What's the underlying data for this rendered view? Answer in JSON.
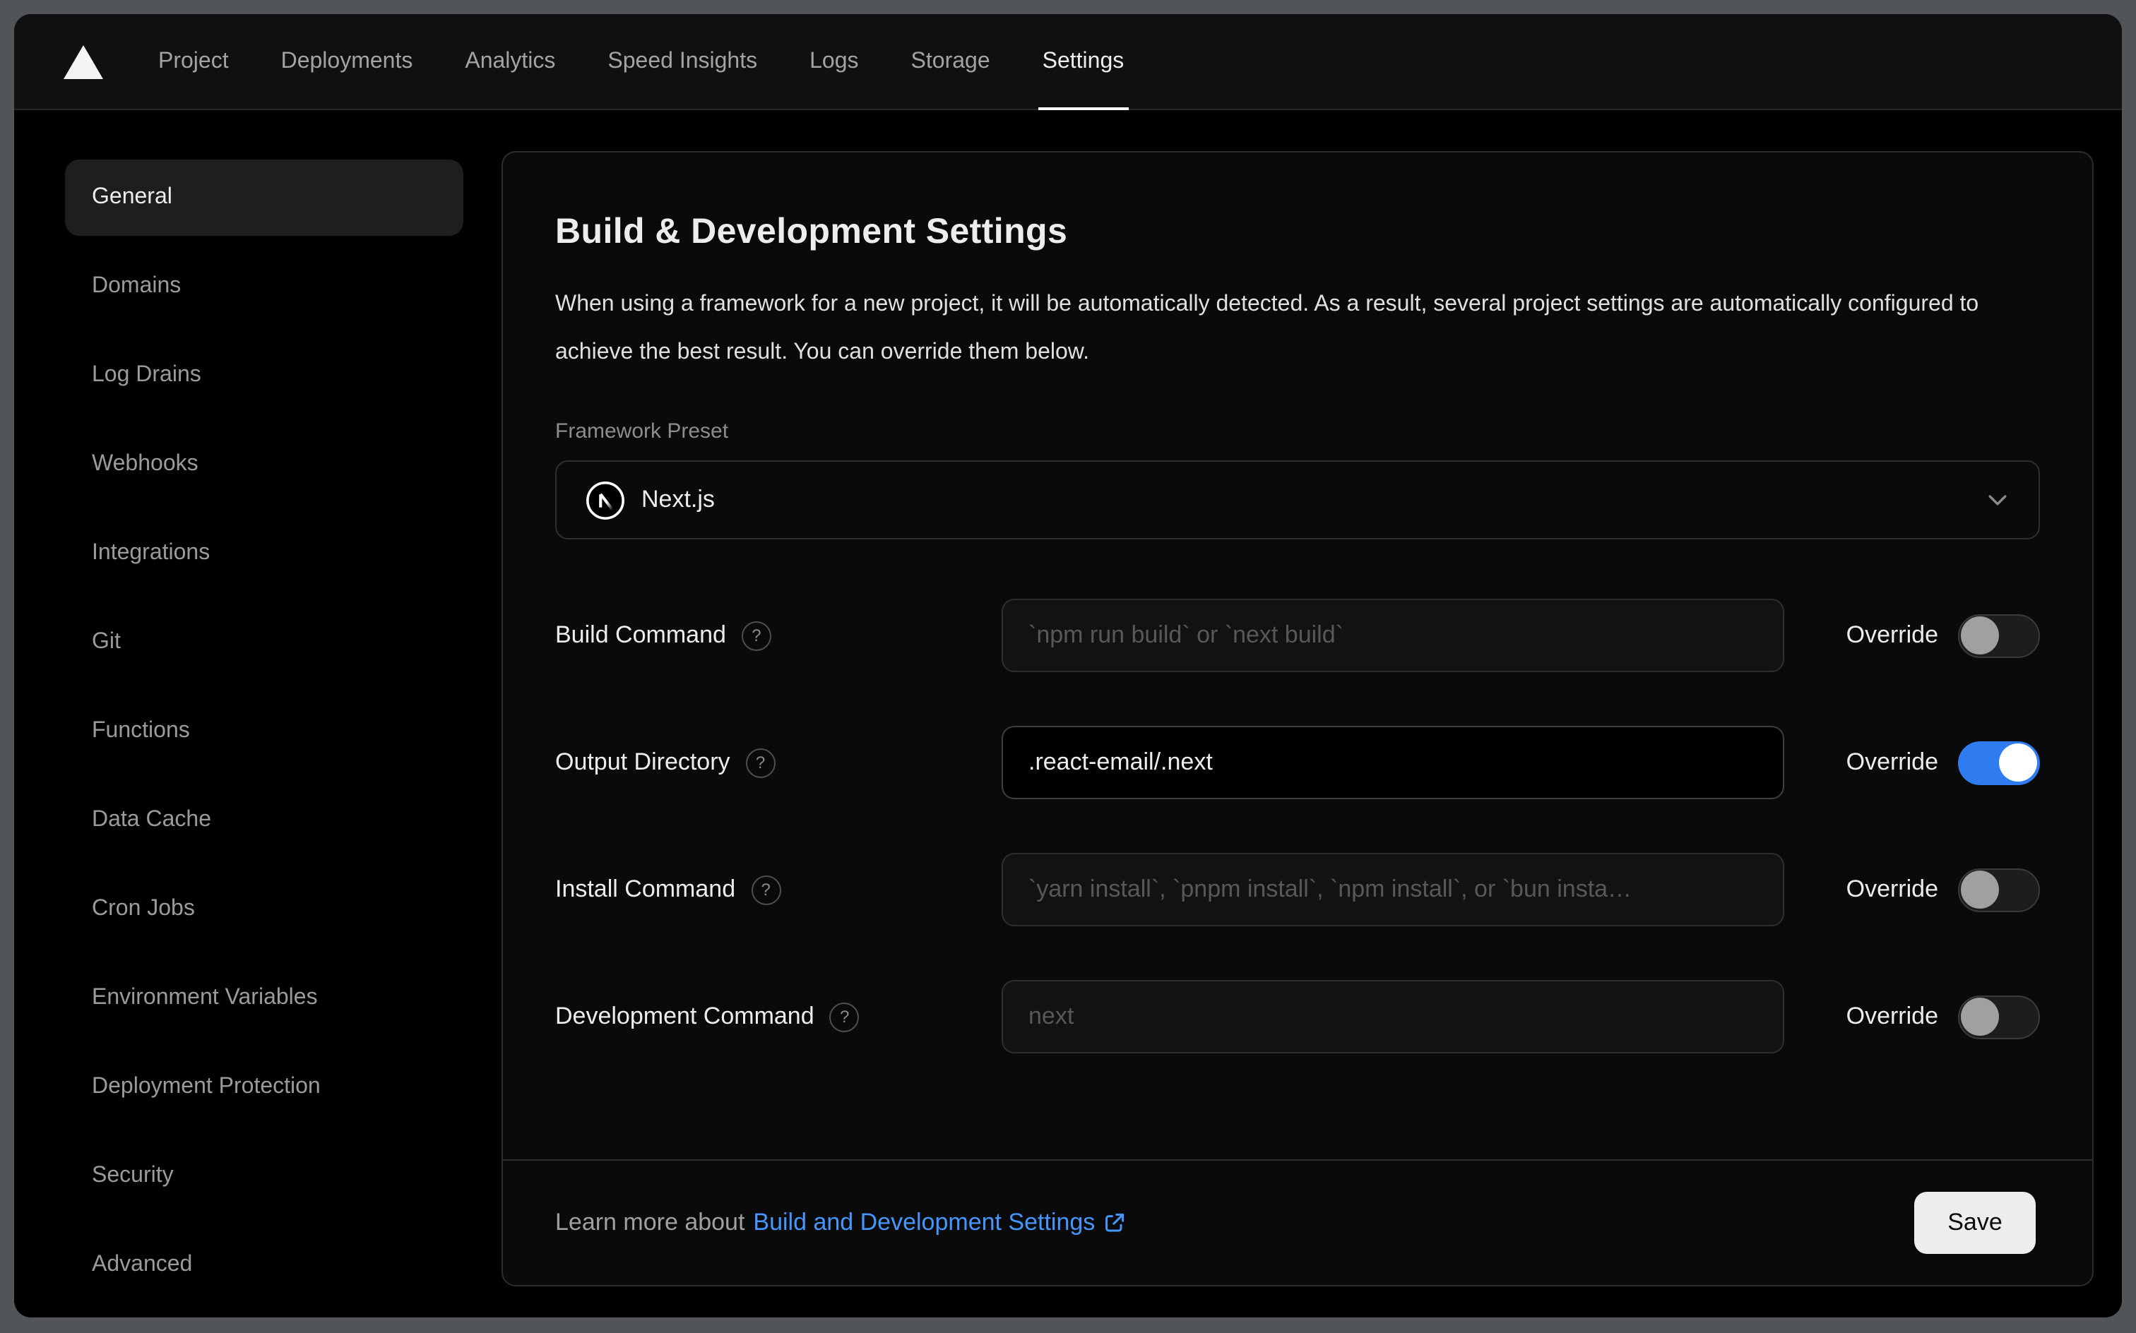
{
  "nav": {
    "logo_icon": "vercel-triangle-icon",
    "tabs": [
      {
        "label": "Project",
        "active": false
      },
      {
        "label": "Deployments",
        "active": false
      },
      {
        "label": "Analytics",
        "active": false
      },
      {
        "label": "Speed Insights",
        "active": false
      },
      {
        "label": "Logs",
        "active": false
      },
      {
        "label": "Storage",
        "active": false
      },
      {
        "label": "Settings",
        "active": true
      }
    ]
  },
  "sidebar": {
    "items": [
      {
        "label": "General",
        "active": true
      },
      {
        "label": "Domains",
        "active": false
      },
      {
        "label": "Log Drains",
        "active": false
      },
      {
        "label": "Webhooks",
        "active": false
      },
      {
        "label": "Integrations",
        "active": false
      },
      {
        "label": "Git",
        "active": false
      },
      {
        "label": "Functions",
        "active": false
      },
      {
        "label": "Data Cache",
        "active": false
      },
      {
        "label": "Cron Jobs",
        "active": false
      },
      {
        "label": "Environment Variables",
        "active": false
      },
      {
        "label": "Deployment Protection",
        "active": false
      },
      {
        "label": "Security",
        "active": false
      },
      {
        "label": "Advanced",
        "active": false
      }
    ]
  },
  "panel": {
    "title": "Build & Development Settings",
    "description": "When using a framework for a new project, it will be automatically detected. As a result, several project settings are automatically configured to achieve the best result. You can override them below.",
    "framework": {
      "label": "Framework Preset",
      "value": "Next.js",
      "icon": "nextjs-logo-icon",
      "chevron_icon": "chevron-down-icon"
    },
    "override_label": "Override",
    "help_glyph": "?",
    "rows": [
      {
        "label": "Build Command",
        "placeholder": "`npm run build` or `next build`",
        "value": "",
        "override": false
      },
      {
        "label": "Output Directory",
        "placeholder": "",
        "value": ".react-email/.next",
        "override": true
      },
      {
        "label": "Install Command",
        "placeholder": "`yarn install`, `pnpm install`, `npm install`, or `bun insta…",
        "value": "",
        "override": false
      },
      {
        "label": "Development Command",
        "placeholder": "next",
        "value": "",
        "override": false
      }
    ],
    "footer": {
      "text_prefix": "Learn more about",
      "link_label": "Build and Development Settings",
      "link_icon": "external-link-icon",
      "save_label": "Save"
    }
  },
  "colors": {
    "toggle_on_blue": "#2e7cf0",
    "link_blue": "#4696ff",
    "active_tab_underline": "#ffffff",
    "panel_border": "#2c2c2c",
    "frame_gray": "#515558"
  }
}
